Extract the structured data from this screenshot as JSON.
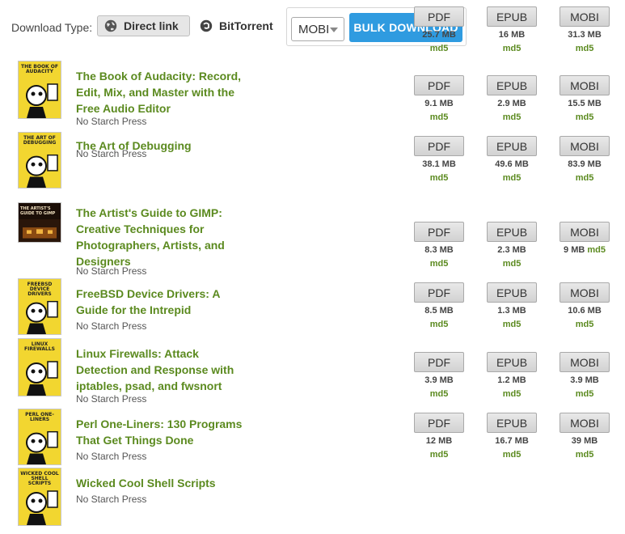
{
  "toolbar": {
    "download_type_label": "Download Type:",
    "direct_link_label": "Direct link",
    "bittorrent_label": "BitTorrent",
    "format_select_value": "MOBI",
    "bulk_download_label": "BULK DOWNLOAD",
    "colors": {
      "accent_blue": "#2f9be0",
      "link_green": "#5b8a1f"
    }
  },
  "books": [
    {
      "title": "The Book of Audacity: Record, Edit, Mix, and Master with the Free Audio Editor",
      "publisher": "No Starch Press",
      "cover_text": "THE BOOK OF AUDACITY",
      "formats": [
        {
          "label": "PDF",
          "size": "25.7 MB",
          "md5": "md5"
        },
        {
          "label": "EPUB",
          "size": "16 MB",
          "md5": "md5"
        },
        {
          "label": "MOBI",
          "size": "31.3 MB",
          "md5": "md5"
        }
      ]
    },
    {
      "title": "The Art of Debugging",
      "publisher": "No Starch Press",
      "cover_text": "THE ART OF DEBUGGING",
      "formats": [
        {
          "label": "PDF",
          "size": "9.1 MB",
          "md5": "md5"
        },
        {
          "label": "EPUB",
          "size": "2.9 MB",
          "md5": "md5"
        },
        {
          "label": "MOBI",
          "size": "15.5 MB",
          "md5": "md5"
        }
      ]
    },
    {
      "title": "The Artist's Guide to GIMP: Creative Techniques for Photographers, Artists, and Designers",
      "publisher": "No Starch Press",
      "cover_text": "THE ARTIST'S GUIDE TO GIMP",
      "formats": [
        {
          "label": "PDF",
          "size": "38.1 MB",
          "md5": "md5"
        },
        {
          "label": "EPUB",
          "size": "49.6 MB",
          "md5": "md5"
        },
        {
          "label": "MOBI",
          "size": "83.9 MB",
          "md5": "md5"
        }
      ]
    },
    {
      "title": "FreeBSD Device Drivers: A Guide for the Intrepid",
      "publisher": "No Starch Press",
      "cover_text": "FREEBSD DEVICE DRIVERS",
      "formats": [
        {
          "label": "PDF",
          "size": "8.3 MB",
          "md5": "md5"
        },
        {
          "label": "EPUB",
          "size": "2.3 MB",
          "md5": "md5"
        },
        {
          "label": "MOBI",
          "size": "9 MB",
          "md5": "md5"
        }
      ]
    },
    {
      "title": "Linux Firewalls: Attack Detection and Response with iptables, psad, and fwsnort",
      "publisher": "No Starch Press",
      "cover_text": "LINUX FIREWALLS",
      "formats": [
        {
          "label": "PDF",
          "size": "8.5 MB",
          "md5": "md5"
        },
        {
          "label": "EPUB",
          "size": "1.3 MB",
          "md5": "md5"
        },
        {
          "label": "MOBI",
          "size": "10.6 MB",
          "md5": "md5"
        }
      ]
    },
    {
      "title": "Perl One-Liners: 130 Programs That Get Things Done",
      "publisher": "No Starch Press",
      "cover_text": "PERL ONE-LINERS",
      "formats": [
        {
          "label": "PDF",
          "size": "3.9 MB",
          "md5": "md5"
        },
        {
          "label": "EPUB",
          "size": "1.2 MB",
          "md5": "md5"
        },
        {
          "label": "MOBI",
          "size": "3.9 MB",
          "md5": "md5"
        }
      ]
    },
    {
      "title": "Wicked Cool Shell Scripts",
      "publisher": "No Starch Press",
      "cover_text": "WICKED COOL SHELL SCRIPTS",
      "formats": [
        {
          "label": "PDF",
          "size": "12 MB",
          "md5": "md5"
        },
        {
          "label": "EPUB",
          "size": "16.7 MB",
          "md5": "md5"
        },
        {
          "label": "MOBI",
          "size": "39 MB",
          "md5": "md5"
        }
      ]
    }
  ]
}
